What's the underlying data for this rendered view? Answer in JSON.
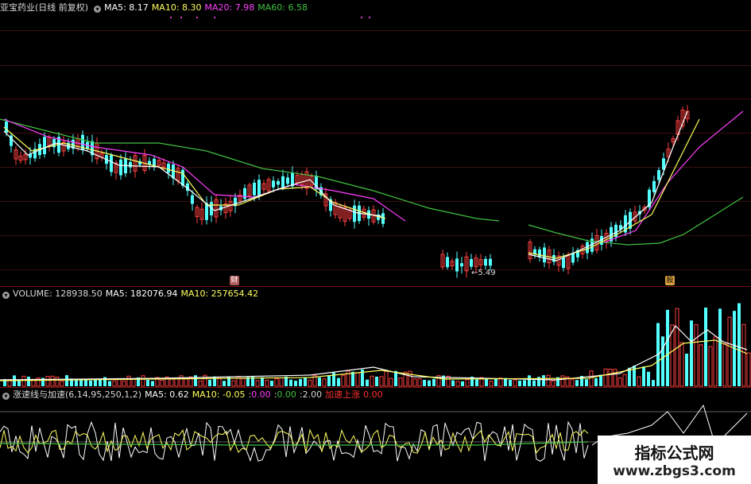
{
  "price_header": {
    "stock_name": "亚宝药业(日线 前复权)",
    "ma5": "MA5: 8.17",
    "ma10": "MA10: 8.30",
    "ma20": "MA20: 7.98",
    "ma60": "MA60: 6.58"
  },
  "price_panel": {
    "low_price_label": "5.49",
    "badge_left": "财",
    "badge_right": "股"
  },
  "volume_header": {
    "volume": "VOLUME: 128938.50",
    "ma5": "MA5: 182076.94",
    "ma10": "MA10: 257654.42"
  },
  "indicator_header": {
    "name": "涨速线与加速(6,14,95,250,1,2)",
    "ma5": "MA5: 0.62",
    "ma10": "MA10: -0.05",
    "v1": "0.00",
    "v2": "0.00",
    "v3": "2.00",
    "signal": "加速上涨",
    "signal_value": "0.00"
  },
  "watermark": {
    "title": "指标公式网",
    "url": "www.zbgs3.com"
  },
  "colors": {
    "up": "#ff4040",
    "down": "#54ffff",
    "ma5": "#ffffff",
    "ma10": "#ffff60",
    "ma20": "#ff40ff",
    "ma60": "#40c040",
    "divider": "#7a1010",
    "accent_red": "#ff3030"
  },
  "chart_data": {
    "type": "candlestick",
    "series": [
      {
        "name": "MA5",
        "values": [
          8.17
        ]
      },
      {
        "name": "MA10",
        "values": [
          8.3
        ]
      },
      {
        "name": "MA20",
        "values": [
          7.98
        ]
      },
      {
        "name": "MA60",
        "values": [
          6.58
        ]
      }
    ],
    "annotations": [
      "5.49"
    ]
  }
}
